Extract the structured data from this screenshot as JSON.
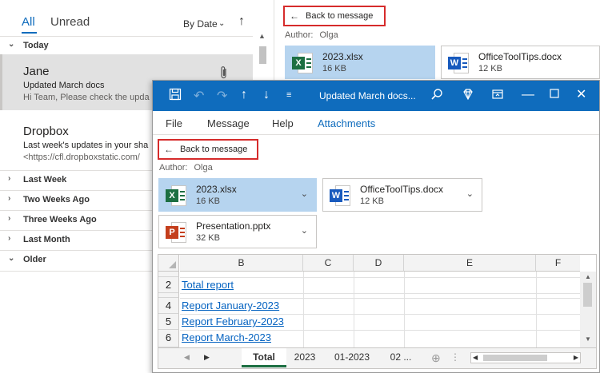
{
  "mail_list": {
    "tabs": [
      {
        "label": "All"
      },
      {
        "label": "Unread"
      }
    ],
    "sort_label": "By Date",
    "groups": {
      "today": "Today",
      "last_week": "Last Week",
      "two_weeks_ago": "Two Weeks Ago",
      "three_weeks_ago": "Three Weeks Ago",
      "last_month": "Last Month",
      "older": "Older"
    },
    "items": [
      {
        "sender": "Jane",
        "subject": "Updated March docs",
        "preview": "Hi Team,  Please check the upda"
      },
      {
        "sender": "Dropbox",
        "subject": "Last week's updates in your sha",
        "preview": "<https://cfl.dropboxstatic.com/"
      }
    ]
  },
  "reading_pane": {
    "back_label": "Back to message",
    "author_label": "Author:",
    "author_name": "Olga",
    "attachments": [
      {
        "name": "2023.xlsx",
        "size": "16 KB",
        "type": "excel",
        "selected": true
      },
      {
        "name": "OfficeToolTips.docx",
        "size": "12 KB",
        "type": "word",
        "selected": false
      }
    ]
  },
  "popup": {
    "title": "Updated March docs...",
    "menu": [
      {
        "label": "File"
      },
      {
        "label": "Message"
      },
      {
        "label": "Help"
      },
      {
        "label": "Attachments",
        "active": true
      }
    ],
    "back_label": "Back to message",
    "author_label": "Author:",
    "author_name": "Olga",
    "attachments": [
      {
        "name": "2023.xlsx",
        "size": "16 KB",
        "type": "excel",
        "selected": true
      },
      {
        "name": "OfficeToolTips.docx",
        "size": "12 KB",
        "type": "word",
        "selected": false
      },
      {
        "name": "Presentation.pptx",
        "size": "32 KB",
        "type": "powerpoint",
        "selected": false
      }
    ],
    "spreadsheet": {
      "columns": [
        "B",
        "C",
        "D",
        "E",
        "F"
      ],
      "rows": [
        {
          "num": "",
          "text": ""
        },
        {
          "num": "2",
          "text": "Total report"
        },
        {
          "num": "",
          "text": ""
        },
        {
          "num": "4",
          "text": "Report January-2023"
        },
        {
          "num": "5",
          "text": "Report February-2023"
        },
        {
          "num": "6",
          "text": "Report March-2023"
        }
      ],
      "sheets": [
        {
          "label": "Total",
          "active": true
        },
        {
          "label": "2023"
        },
        {
          "label": "01-2023"
        },
        {
          "label": "02 ..."
        }
      ]
    }
  },
  "colors": {
    "accent": "#0f6cbd",
    "highlight_border": "#d62b2b",
    "attachment_selected": "#b6d4ef",
    "excel": "#1d6f42",
    "word": "#185abd",
    "powerpoint": "#c43e1c",
    "link": "#0563c1"
  }
}
